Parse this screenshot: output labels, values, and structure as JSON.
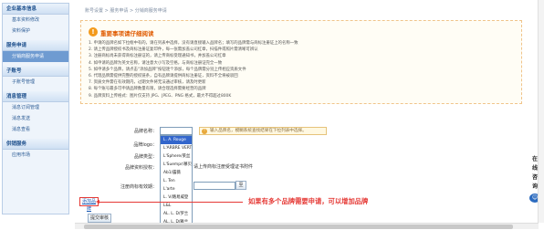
{
  "sidebar": {
    "sections": [
      {
        "header": "企业基本信息",
        "items": [
          "基本资料修改",
          "资料保护"
        ]
      },
      {
        "header": "服务申请",
        "items": [
          "分销商服务申请"
        ]
      },
      {
        "header": "子账号",
        "items": [
          "子账号管理"
        ]
      },
      {
        "header": "消息管理",
        "items": [
          "消息订阅管理",
          "消息发送",
          "消息查看"
        ]
      },
      {
        "header": "供销服务",
        "items": [
          "应用市场"
        ]
      }
    ],
    "active_item": "分销商服务申请"
  },
  "breadcrumb": "账号设置 > 服务申请 > 分销商服务申请",
  "notice": {
    "icon": "exclamation-icon",
    "title": "重要事项请仔细阅读",
    "lines": [
      "1. 申请的品牌名如下拉框中有的，请在列表中选择，没有请直接输入品牌名；填写的品牌需与商标注册证上的名称一致",
      "2. 请上传品牌授权书及商标注册证复印件，每一张需加盖公司红章，扫描件或照片需清晰可辨认",
      "3. 注册商标尚未获得商标注册证的，请上传商标受理通知书，并加盖公司红章",
      "4. 如申请的品牌为英文名称，请注意大小写及空格，与商标注册证完全一致",
      "5. 如申请多个品牌，请点击“添加品牌”按钮逐个添加，每个品牌需分别上传相应资质文件",
      "6. 代理品牌需提供完整的授权链条，自有品牌请提供商标注册证，资料不全将被驳回",
      "7. 资质文件需在有效期内，过期文件将无法通过审核，请及时更新",
      "8. 每个账号最多可申请品牌数量有限，请合理选择需要经营的品牌",
      "9. 品牌资料上传格式：图片仅支持 JPG、JPEG、PNG 格式，最大不得超过800K"
    ]
  },
  "form": {
    "brand_label": "品牌名称：",
    "brand_hint": "输入品牌名，模糊系统查找结果在下拉列表中选择。",
    "logo_label": "品牌logo：",
    "type_label": "品牌类型：",
    "qualification_label": "品牌资料授权：",
    "upload_text": "请上传商标注册受理证书附件",
    "trademark_label": "注册商标有效期：",
    "trademark_button": "至",
    "add_brand_label": "添加品牌",
    "submit_label": "提交审核"
  },
  "dropdown": {
    "items": [
      "L. A. Rouge",
      "L'ARBRE VERT/绿树",
      "L'Sphere/莱丝",
      "L'Suempr/慕贝",
      "Ab1/露薇",
      "L. Ten",
      "L'arte",
      "L. V/路易威登",
      "L&L",
      "AL. L. D/罗兰",
      "AL. L. D/雅兰"
    ],
    "selected_index": 0
  },
  "annotation": "如果有多个品牌需要申请，可以增加品牌",
  "consult": {
    "text": "在线咨询",
    "icon": "chat-icon"
  }
}
